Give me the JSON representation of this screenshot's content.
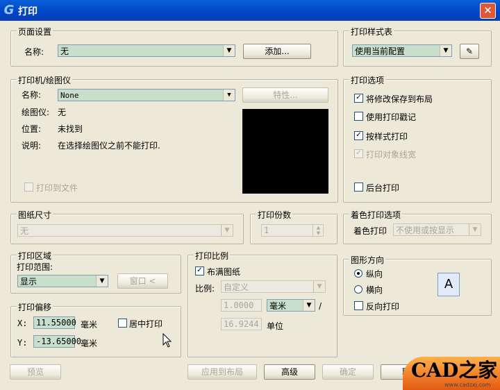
{
  "title": "打印",
  "page_setup": {
    "legend": "页面设置",
    "name_label": "名称:",
    "name_value": "无",
    "add_btn": "添加..."
  },
  "style_table": {
    "legend": "打印样式表",
    "value": "使用当前配置"
  },
  "printer": {
    "legend": "打印机/绘图仪",
    "name_label": "名称:",
    "name_value": "None",
    "props_btn": "特性...",
    "plotter_label": "绘图仪:",
    "plotter_value": "无",
    "location_label": "位置:",
    "location_value": "未找到",
    "desc_label": "说明:",
    "desc_value": "在选择绘图仪之前不能打印.",
    "print_to_file": "打印到文件"
  },
  "print_options": {
    "legend": "打印选项",
    "items": [
      "将修改保存到布局",
      "使用打印戳记",
      "按样式打印",
      "打印对象线宽",
      "后台打印"
    ]
  },
  "paper_size": {
    "legend": "图纸尺寸",
    "value": "无"
  },
  "copies": {
    "legend": "打印份数",
    "value": "1"
  },
  "shade": {
    "legend": "着色打印选项",
    "label": "着色打印",
    "value": "不使用或按显示"
  },
  "area": {
    "legend": "打印区域",
    "range_label": "打印范围:",
    "range_value": "显示",
    "window_btn": "窗口 <"
  },
  "scale": {
    "legend": "打印比例",
    "fit_label": "布满图纸",
    "ratio_label": "比例:",
    "ratio_value": "自定义",
    "num1": "1.0000",
    "unit": "毫米",
    "slash": "/",
    "num2": "16.9244",
    "unit2": "单位"
  },
  "offset": {
    "legend": "打印偏移",
    "x_label": "X:",
    "x_value": "11.55000",
    "y_label": "Y:",
    "y_value": "-13.65000",
    "unit": "毫米",
    "center_label": "居中打印"
  },
  "orientation": {
    "legend": "图形方向",
    "portrait": "纵向",
    "landscape": "横向",
    "reverse": "反向打印",
    "icon_letter": "A"
  },
  "buttons": {
    "preview": "预览",
    "apply": "应用到布局",
    "advanced": "高级",
    "ok": "确定",
    "cancel": "取"
  },
  "logo": {
    "text": "CAD之家",
    "sub": "www.cadzxj.com"
  }
}
